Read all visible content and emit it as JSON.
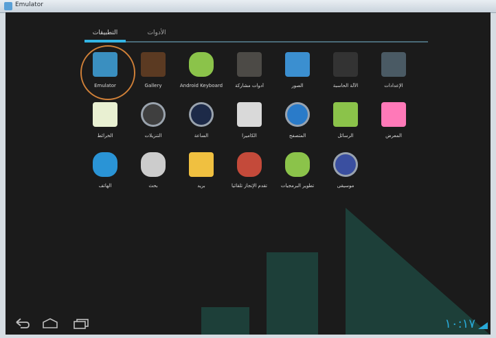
{
  "window": {
    "title": "Emulator"
  },
  "tabs": {
    "apps": "التطبيقات",
    "widgets": "الأدوات"
  },
  "apps": [
    {
      "label": "Emulator",
      "icon": "emulator-app-icon",
      "color": "#3a8fc0"
    },
    {
      "label": "Gallery",
      "icon": "photo-frame-icon",
      "color": "#5b3a22"
    },
    {
      "label": "Android Keyboard",
      "icon": "android-robot-icon",
      "color": "#8bc34a"
    },
    {
      "label": "أدوات مشاركة",
      "icon": "clapperboard-icon",
      "color": "#4c4a46"
    },
    {
      "label": "الصور",
      "icon": "contacts-book-icon",
      "color": "#3b8fd0"
    },
    {
      "label": "الآلة الحاسبة",
      "icon": "calculator-icon",
      "color": "#333333"
    },
    {
      "label": "الإعدادات",
      "icon": "settings-sliders-icon",
      "color": "#4a5a64"
    },
    {
      "label": "الخرائط",
      "icon": "map-icon",
      "color": "#e9f0d2"
    },
    {
      "label": "التنزيلات",
      "icon": "download-arrow-icon",
      "color": "#3f3f3f"
    },
    {
      "label": "الساعة",
      "icon": "clock-icon",
      "color": "#1d2a48"
    },
    {
      "label": "الكاميرا",
      "icon": "camera-icon",
      "color": "#d9d9d9"
    },
    {
      "label": "المتصفح",
      "icon": "globe-icon",
      "color": "#2a7bc9"
    },
    {
      "label": "الرسائل",
      "icon": "message-bubble-icon",
      "color": "#8bc34a"
    },
    {
      "label": "المعرض",
      "icon": "gallery-picture-icon",
      "color": "#ff79b8"
    },
    {
      "label": "الهاتف",
      "icon": "phone-handset-icon",
      "color": "#2a94d6"
    },
    {
      "label": "بحث",
      "icon": "magnifier-icon",
      "color": "#cccccc"
    },
    {
      "label": "بريد",
      "icon": "envelope-icon",
      "color": "#f0c040"
    },
    {
      "label": "تقدم الإنجاز تلقائيا",
      "icon": "dev-tools-robot-icon",
      "color": "#c44a3a"
    },
    {
      "label": "تطوير البرمجيات",
      "icon": "android-robot-icon",
      "color": "#8bc34a"
    },
    {
      "label": "موسيقى",
      "icon": "music-disc-icon",
      "color": "#3a4fa0"
    }
  ],
  "status": {
    "time": "١٠:١٧"
  }
}
